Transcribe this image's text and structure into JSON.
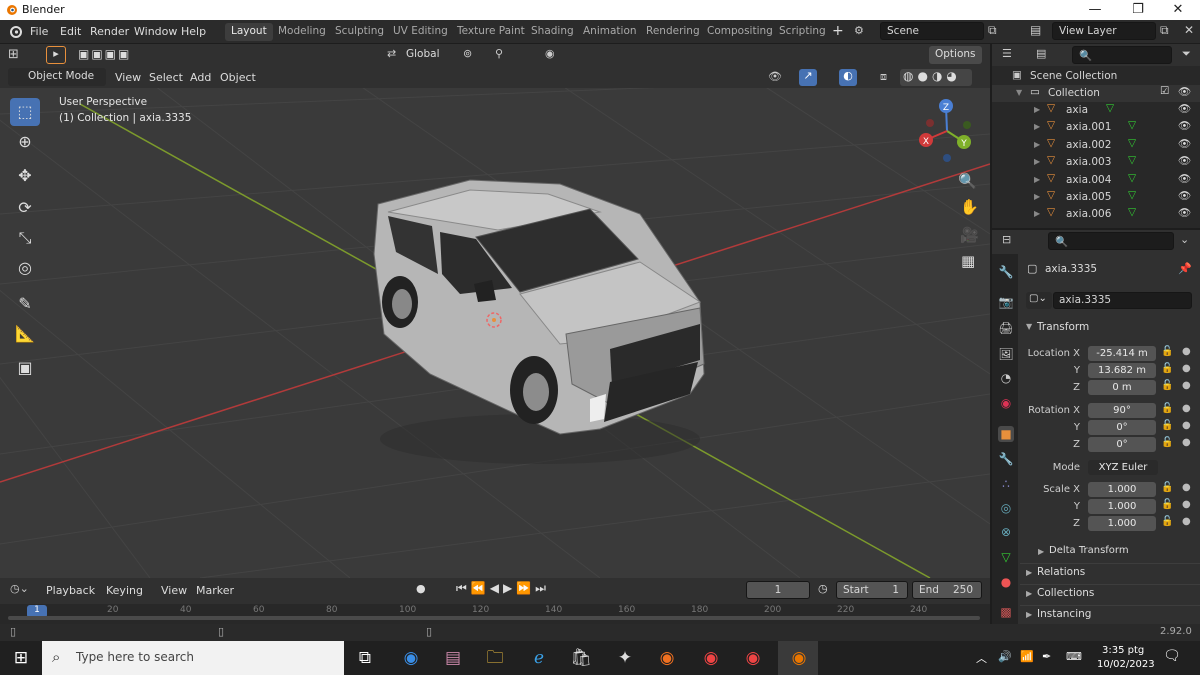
{
  "window": {
    "app_title": "Blender",
    "minimize": "—",
    "maximize": "❐",
    "close": "✕"
  },
  "menu": {
    "items": [
      "File",
      "Edit",
      "Render",
      "Window",
      "Help"
    ],
    "workspaces": [
      "Layout",
      "Modeling",
      "Sculpting",
      "UV Editing",
      "Texture Paint",
      "Shading",
      "Animation",
      "Rendering",
      "Compositing",
      "Scripting"
    ],
    "add": "+",
    "scene_value": "Scene",
    "view_layer_value": "View Layer"
  },
  "viewport": {
    "mode": "Object Mode",
    "menus": [
      "View",
      "Select",
      "Add",
      "Object"
    ],
    "orientation": "Global",
    "options": "Options",
    "view_title": "User Perspective",
    "view_subtitle": "(1) Collection | axia.3335",
    "gizmo": {
      "z": "Z",
      "y": "Y",
      "x": "X"
    }
  },
  "outliner": {
    "root": "Scene Collection",
    "collection": "Collection",
    "objects": [
      "axia",
      "axia.001",
      "axia.002",
      "axia.003",
      "axia.004",
      "axia.005",
      "axia.006"
    ]
  },
  "properties": {
    "object_name": "axia.3335",
    "data_name": "axia.3335",
    "transform_label": "Transform",
    "location": {
      "label": "Location X",
      "x": "-25.414 m",
      "y_label": "Y",
      "y": "13.682 m",
      "z_label": "Z",
      "z": "0 m"
    },
    "rotation": {
      "label": "Rotation X",
      "x": "90°",
      "y_label": "Y",
      "y": "0°",
      "z_label": "Z",
      "z": "0°"
    },
    "mode": {
      "label": "Mode",
      "value": "XYZ Euler"
    },
    "scale": {
      "label": "Scale X",
      "x": "1.000",
      "y_label": "Y",
      "y": "1.000",
      "z_label": "Z",
      "z": "1.000"
    },
    "delta": "Delta Transform",
    "relations": "Relations",
    "collections": "Collections",
    "instancing": "Instancing"
  },
  "timeline": {
    "menus": [
      "Playback",
      "Keying",
      "View",
      "Marker"
    ],
    "current_frame": "1",
    "start_label": "Start",
    "start": "1",
    "end_label": "End",
    "end": "250",
    "ticks": [
      "0",
      "20",
      "40",
      "60",
      "80",
      "100",
      "120",
      "140",
      "160",
      "180",
      "200",
      "220",
      "240"
    ],
    "playhead": "1"
  },
  "status": {
    "version": "2.92.0"
  },
  "taskbar": {
    "search_placeholder": "Type here to search",
    "time": "3:35 ptg",
    "date": "10/02/2023"
  },
  "colors": {
    "accent": "#4772b3",
    "active_object": "#e8903c",
    "viewport_bg": "#3a3a3a",
    "x_axis": "#b23a3a",
    "y_axis": "#7c9a2c"
  }
}
